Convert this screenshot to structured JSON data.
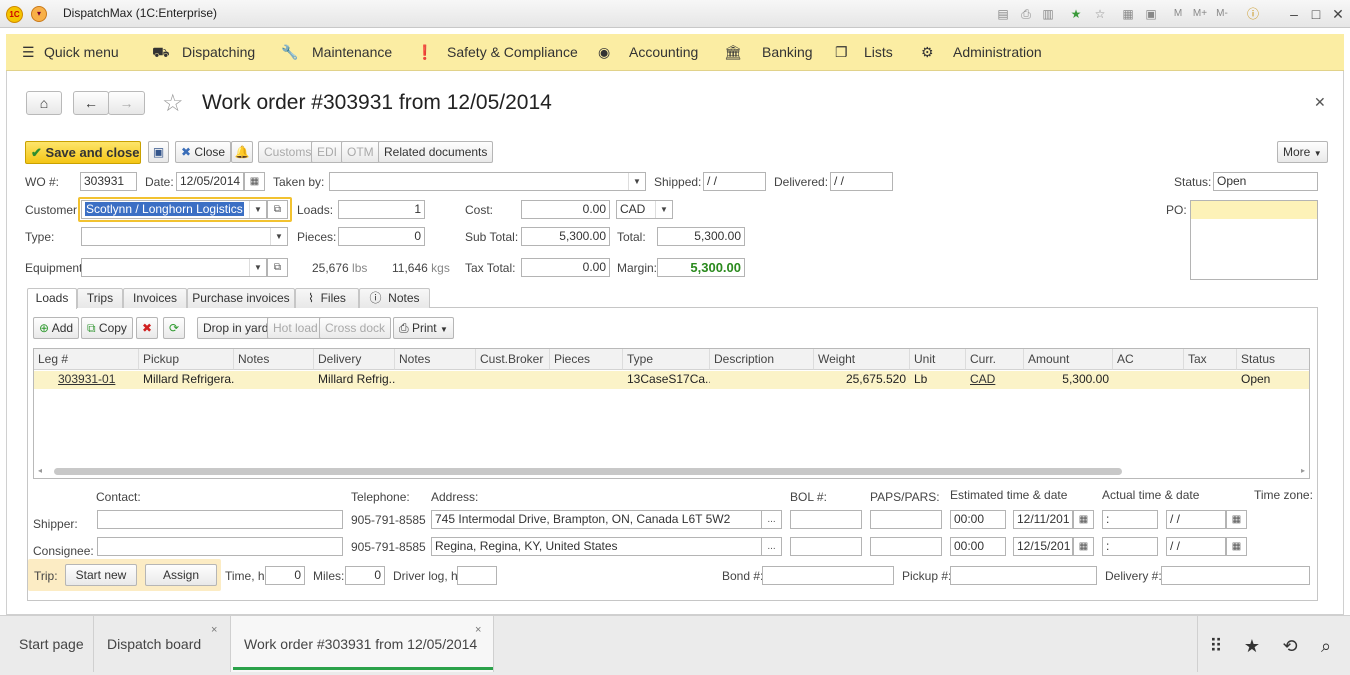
{
  "app": {
    "title": "DispatchMax  (1C:Enterprise)",
    "logo": "1C"
  },
  "menu": {
    "items": [
      {
        "label": "Quick menu",
        "icon": "hamburger-icon"
      },
      {
        "label": "Dispatching",
        "icon": "truck-icon"
      },
      {
        "label": "Maintenance",
        "icon": "wrench-icon"
      },
      {
        "label": "Safety & Compliance",
        "icon": "exclamation-icon"
      },
      {
        "label": "Accounting",
        "icon": "coins-icon"
      },
      {
        "label": "Banking",
        "icon": "bank-icon"
      },
      {
        "label": "Lists",
        "icon": "list-icon"
      },
      {
        "label": "Administration",
        "icon": "gear-icon"
      }
    ]
  },
  "form": {
    "title": "Work order #303931 from 12/05/2014",
    "toolbar": {
      "save_close": "Save and close",
      "close": "Close",
      "customs": "Customs",
      "edi": "EDI",
      "otm": "OTM",
      "related": "Related documents",
      "more": "More"
    },
    "header": {
      "wo_label": "WO #:",
      "wo_value": "303931",
      "date_label": "Date:",
      "date_value": "12/05/2014",
      "taken_by_label": "Taken by:",
      "taken_by_value": "",
      "shipped_label": "Shipped:",
      "shipped_value": " /  /",
      "delivered_label": "Delivered:",
      "delivered_value": " /  /",
      "status_label": "Status:",
      "status_value": "Open",
      "customer_label": "Customer:",
      "customer_value": "Scotlynn / Longhorn Logistics",
      "loads_label": "Loads:",
      "loads_value": "1",
      "cost_label": "Cost:",
      "cost_value": "0.00",
      "currency_value": "CAD",
      "po_label": "PO:",
      "type_label": "Type:",
      "type_value": "",
      "pieces_label": "Pieces:",
      "pieces_value": "0",
      "subtotal_label": "Sub Total:",
      "subtotal_value": "5,300.00",
      "total_label": "Total:",
      "total_value": "5,300.00",
      "equipment_label": "Equipment:",
      "equipment_value": "",
      "weight_lbs": "25,676",
      "lbs_unit": "lbs",
      "weight_kgs": "11,646",
      "kgs_unit": "kgs",
      "taxtotal_label": "Tax Total:",
      "taxtotal_value": "0.00",
      "margin_label": "Margin:",
      "margin_value": "5,300.00"
    },
    "tabs": [
      "Loads",
      "Trips",
      "Invoices",
      "Purchase invoices",
      "Files",
      "Notes"
    ],
    "loads_toolbar": {
      "add": "Add",
      "copy": "Copy",
      "drop_in_yard": "Drop in yard",
      "hot_load": "Hot load",
      "cross_dock": "Cross dock",
      "print": "Print"
    },
    "grid": {
      "columns": [
        "Leg #",
        "Pickup",
        "Notes",
        "Delivery",
        "Notes",
        "Cust.Broker",
        "Pieces",
        "Type",
        "Description",
        "Weight",
        "Unit",
        "Curr.",
        "Amount",
        "AC",
        "Tax",
        "Status"
      ],
      "rows": [
        {
          "leg": "303931-01",
          "pickup": "Millard Refrigera...",
          "pickup_notes": "",
          "delivery": "Millard Refrig...",
          "delivery_notes": "",
          "broker": "",
          "pieces": "",
          "type": "13CaseS17Ca...",
          "description": "",
          "weight": "25,675.520",
          "unit": "Lb",
          "curr": "CAD",
          "amount": "5,300.00",
          "ac": "",
          "tax": "",
          "status": "Open"
        }
      ]
    },
    "contacts": {
      "contact_label": "Contact:",
      "telephone_label": "Telephone:",
      "address_label": "Address:",
      "bol_label": "BOL #:",
      "paps_label": "PAPS/PARS:",
      "est_label": "Estimated time & date",
      "actual_label": "Actual time & date",
      "tz_label": "Time zone:",
      "shipper_label": "Shipper:",
      "consignee_label": "Consignee:",
      "shipper": {
        "contact": "",
        "phone": "905-791-8585",
        "address": "745 Intermodal Drive, Brampton, ON, Canada L6T 5W2",
        "bol": "",
        "paps": "",
        "est_time": "00:00",
        "est_date": "12/11/201",
        "act_time": "  :",
        "act_date": " /  /"
      },
      "consignee": {
        "contact": "",
        "phone": "905-791-8585",
        "address": "Regina, Regina, KY, United States",
        "bol": "",
        "paps": "",
        "est_time": "00:00",
        "est_date": "12/15/201",
        "act_time": "  :",
        "act_date": " /  /"
      }
    },
    "trip": {
      "label": "Trip:",
      "start_new": "Start new",
      "assign": "Assign",
      "time_label": "Time, h:",
      "time_value": "0",
      "miles_label": "Miles:",
      "miles_value": "0",
      "driverlog_label": "Driver log, h:",
      "driverlog_value": "",
      "bond_label": "Bond #:",
      "bond_value": "",
      "pickup_label": "Pickup #:",
      "pickup_value": "",
      "delivery_label": "Delivery #:",
      "delivery_value": ""
    }
  },
  "taskbar": {
    "tabs": [
      "Start page",
      "Dispatch board",
      "Work order #303931 from 12/05/2014"
    ]
  },
  "colors": {
    "menu_bg": "#fbeda3",
    "accent_yellow": "#f4c515",
    "margin_green": "#2a8a1d",
    "row_highlight": "#fbf3c8",
    "active_tab_line": "#2ba24a"
  }
}
